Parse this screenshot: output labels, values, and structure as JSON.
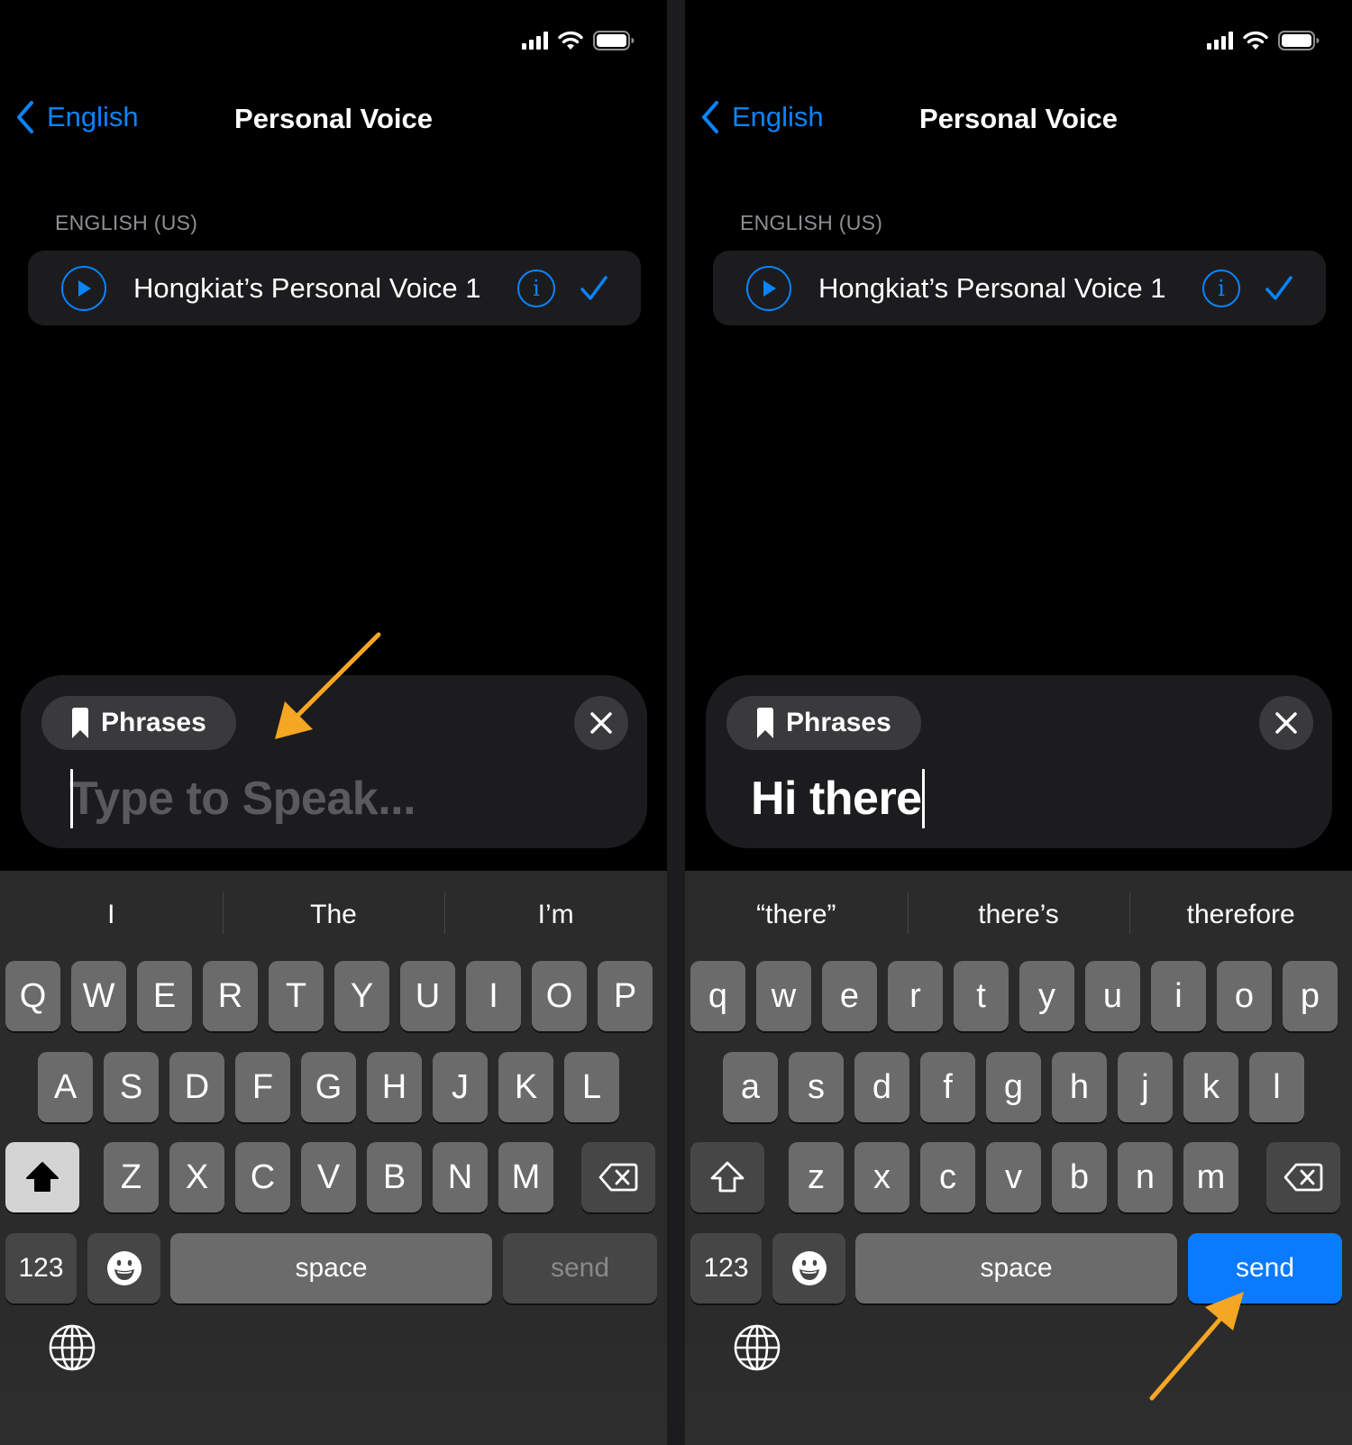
{
  "screens": [
    {
      "status": {
        "signal_icon": "cellular-signal-icon",
        "wifi_icon": "wifi-icon",
        "battery_icon": "battery-icon"
      },
      "nav": {
        "back_label": "English",
        "title": "Personal Voice"
      },
      "section_label": "ENGLISH (US)",
      "voice": {
        "name": "Hongkiat’s Personal Voice 1",
        "info_glyph": "i",
        "selected": true
      },
      "speak_panel": {
        "phrases_label": "Phrases",
        "placeholder": "Type to Speak...",
        "value": ""
      },
      "suggestions": [
        "I",
        "The",
        "I’m"
      ],
      "keys": {
        "row1": [
          "Q",
          "W",
          "E",
          "R",
          "T",
          "Y",
          "U",
          "I",
          "O",
          "P"
        ],
        "row2": [
          "A",
          "S",
          "D",
          "F",
          "G",
          "H",
          "J",
          "K",
          "L"
        ],
        "row3": [
          "Z",
          "X",
          "C",
          "V",
          "B",
          "N",
          "M"
        ],
        "numbers_label": "123",
        "space_label": "space",
        "send_label": "send",
        "shift_state": "on",
        "send_enabled": false
      },
      "annotation": "arrow pointing to Type to Speak field"
    },
    {
      "status": {
        "signal_icon": "cellular-signal-icon",
        "wifi_icon": "wifi-icon",
        "battery_icon": "battery-icon"
      },
      "nav": {
        "back_label": "English",
        "title": "Personal Voice"
      },
      "section_label": "ENGLISH (US)",
      "voice": {
        "name": "Hongkiat’s Personal Voice 1",
        "info_glyph": "i",
        "selected": true
      },
      "speak_panel": {
        "phrases_label": "Phrases",
        "placeholder": "",
        "value": "Hi there"
      },
      "suggestions": [
        "“there”",
        "there’s",
        "therefore"
      ],
      "keys": {
        "row1": [
          "q",
          "w",
          "e",
          "r",
          "t",
          "y",
          "u",
          "i",
          "o",
          "p"
        ],
        "row2": [
          "a",
          "s",
          "d",
          "f",
          "g",
          "h",
          "j",
          "k",
          "l"
        ],
        "row3": [
          "z",
          "x",
          "c",
          "v",
          "b",
          "n",
          "m"
        ],
        "numbers_label": "123",
        "space_label": "space",
        "send_label": "send",
        "shift_state": "off",
        "send_enabled": true
      },
      "annotation": "arrow pointing to send key"
    }
  ],
  "colors": {
    "accent": "#0a84ff",
    "send_active": "#0a7aff",
    "annotation_arrow": "#f5a623",
    "key": "#6b6b6b",
    "key_dark": "#464646",
    "keyboard_bg": "#2b2b2b",
    "panel_bg": "#1c1c1e"
  }
}
